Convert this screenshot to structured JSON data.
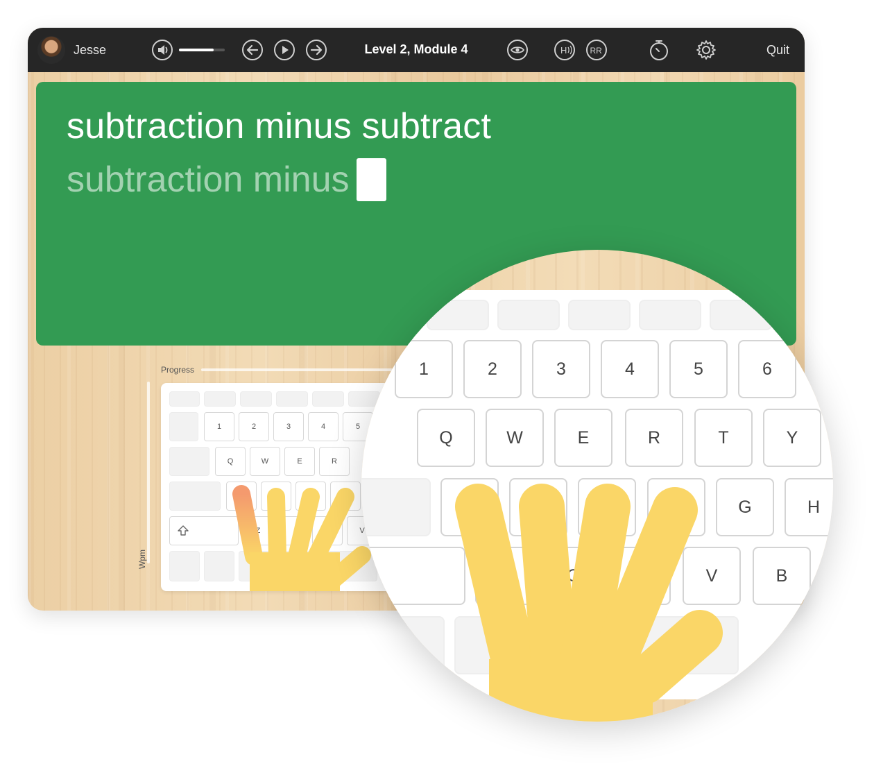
{
  "user": {
    "name": "Jesse"
  },
  "toolbar": {
    "lesson_title": "Level 2, Module 4",
    "quit_label": "Quit",
    "volume_level": 0.75,
    "icons": [
      "volume-icon",
      "back-icon",
      "play-icon",
      "forward-icon",
      "eye-icon",
      "hint-audio-icon",
      "repeat-icon",
      "timer-icon",
      "gear-icon"
    ],
    "hint_label": "H",
    "repeat_label": "RR"
  },
  "lesson": {
    "target_text": "subtraction minus subtract",
    "typed_text": "subtraction minus"
  },
  "stats": {
    "progress_label": "Progress",
    "wpm_label": "Wpm"
  },
  "small_keyboard": {
    "number_row": [
      "1",
      "2",
      "3",
      "4",
      "5"
    ],
    "top_row": [
      "Q",
      "W",
      "E",
      "R"
    ],
    "bottom_row_partial": [
      "Z",
      "V"
    ],
    "shift_icon": "shift-icon"
  },
  "big_keyboard": {
    "number_row": [
      "1",
      "2",
      "3",
      "4",
      "5",
      "6"
    ],
    "top_row": [
      "Q",
      "W",
      "E",
      "R",
      "T",
      "Y"
    ],
    "home_row_visible": [
      "G",
      "H"
    ],
    "bottom_row_visible": [
      "X",
      "C",
      "V",
      "B"
    ]
  },
  "colors": {
    "panel_green": "#339b53",
    "toolbar_dark": "#262626",
    "hand_yellow": "#fad667",
    "highlight_finger": "#f49a6e"
  }
}
